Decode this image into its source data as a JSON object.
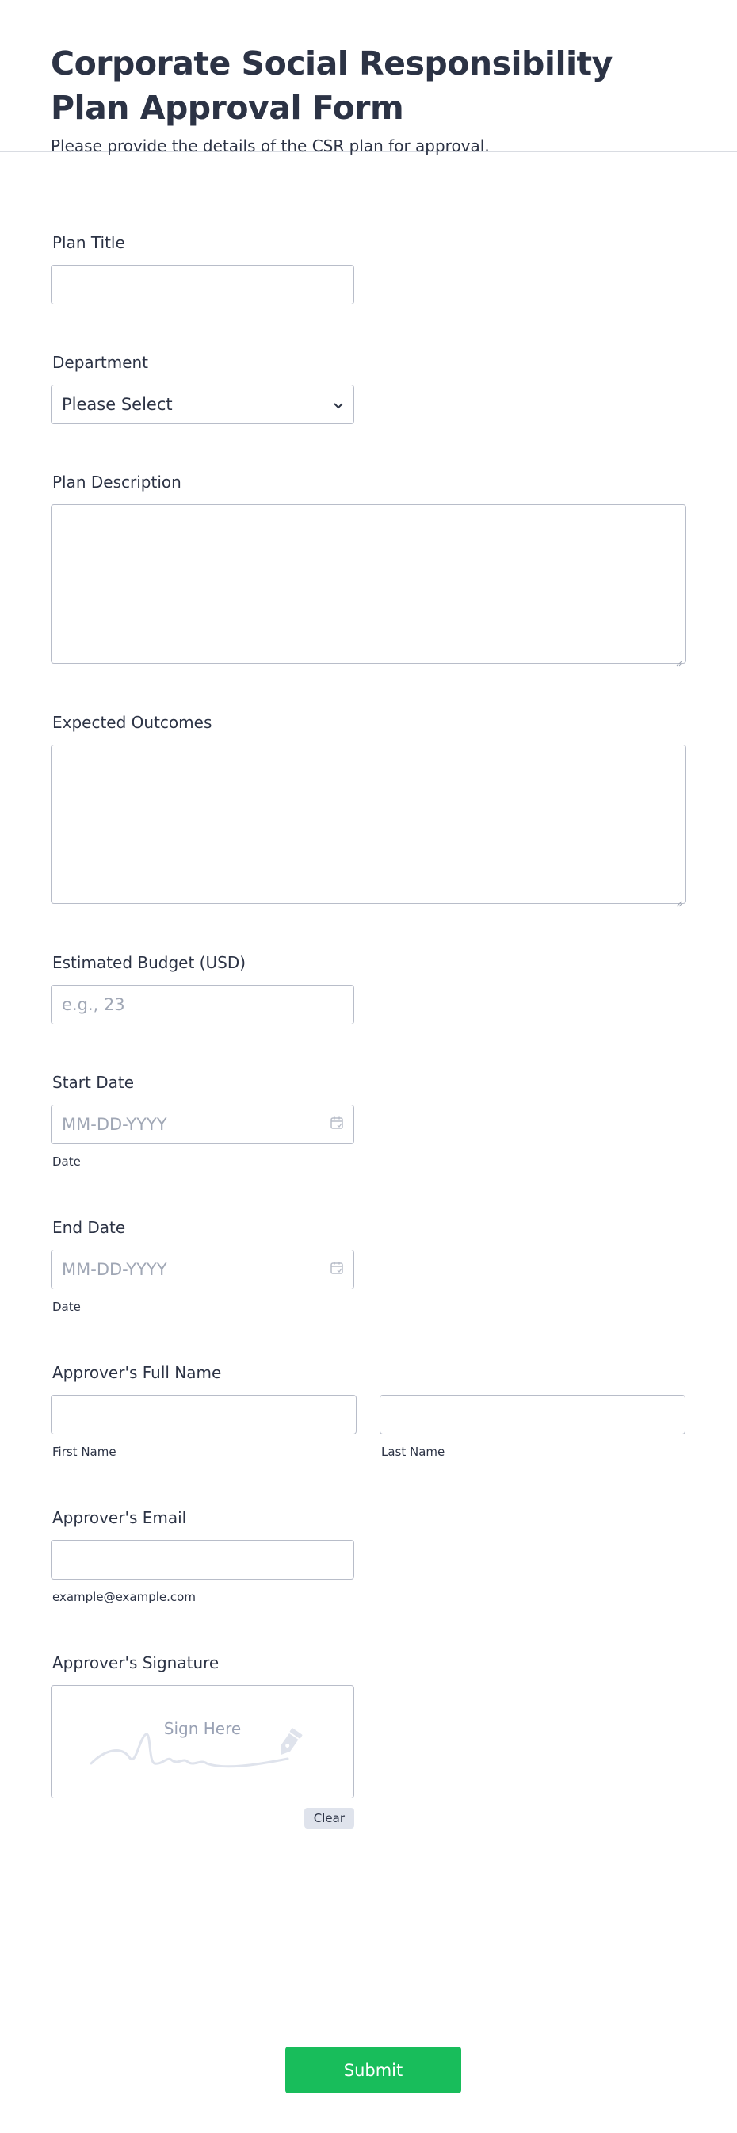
{
  "header": {
    "title": "Corporate Social Responsibility Plan Approval Form",
    "subtitle": "Please provide the details of the CSR plan for approval."
  },
  "fields": {
    "plan_title": {
      "label": "Plan Title",
      "value": ""
    },
    "department": {
      "label": "Department",
      "selected": "Please Select"
    },
    "plan_description": {
      "label": "Plan Description"
    },
    "expected_outcomes": {
      "label": "Expected Outcomes"
    },
    "budget": {
      "label": "Estimated Budget (USD)",
      "placeholder": "e.g., 23"
    },
    "start_date": {
      "label": "Start Date",
      "placeholder": "MM-DD-YYYY",
      "sublabel": "Date"
    },
    "end_date": {
      "label": "End Date",
      "placeholder": "MM-DD-YYYY",
      "sublabel": "Date"
    },
    "approver_name": {
      "label": "Approver's Full Name",
      "first_sublabel": "First Name",
      "last_sublabel": "Last Name"
    },
    "approver_email": {
      "label": "Approver's Email",
      "sublabel": "example@example.com"
    },
    "signature": {
      "label": "Approver's Signature",
      "placeholder": "Sign Here",
      "clear_label": "Clear"
    }
  },
  "submit_label": "Submit",
  "colors": {
    "submit": "#18bd5b",
    "text": "#2c3345",
    "border": "#b8bdc9"
  }
}
